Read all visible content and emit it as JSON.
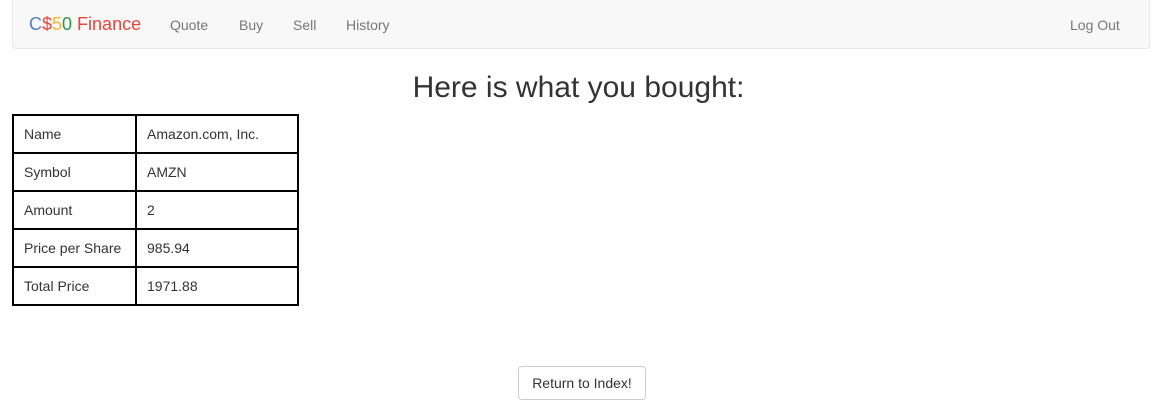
{
  "navbar": {
    "brand": [
      {
        "text": "C",
        "color": "#537fbe"
      },
      {
        "text": "$",
        "color": "#ea433b"
      },
      {
        "text": "5",
        "color": "#f5b82e"
      },
      {
        "text": "0",
        "color": "#2e944b"
      },
      {
        "text": " Finance",
        "color": "#ea433b"
      }
    ],
    "links": [
      "Quote",
      "Buy",
      "Sell",
      "History"
    ],
    "logout": "Log Out"
  },
  "main": {
    "heading": "Here is what you bought:",
    "rows": [
      {
        "label": "Name",
        "value": "Amazon.com, Inc."
      },
      {
        "label": "Symbol",
        "value": "AMZN"
      },
      {
        "label": "Amount",
        "value": "2"
      },
      {
        "label": "Price per Share",
        "value": "985.94"
      },
      {
        "label": "Total Price",
        "value": "1971.88"
      }
    ],
    "button": "Return to Index!"
  }
}
